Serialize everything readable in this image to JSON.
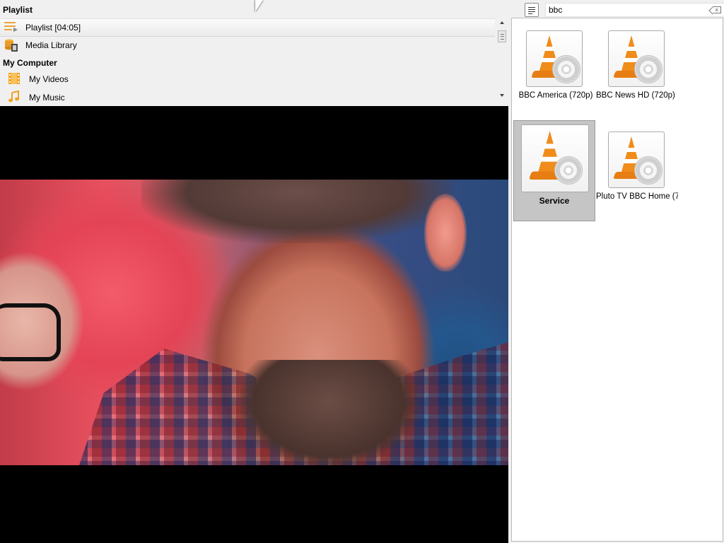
{
  "sidebar": {
    "playlist_header": "Playlist",
    "items": [
      {
        "label": "Playlist [04:05]",
        "icon": "playlist-icon",
        "selected": true
      },
      {
        "label": "Media Library",
        "icon": "media-library-icon"
      }
    ],
    "computer_header": "My Computer",
    "computer_items": [
      {
        "label": "My Videos",
        "icon": "film-icon"
      },
      {
        "label": "My Music",
        "icon": "music-note-icon"
      }
    ]
  },
  "search": {
    "value": "bbc"
  },
  "results": [
    {
      "label": "BBC America (720p)",
      "icon": "vlc-cone-icon"
    },
    {
      "label": "BBC News HD (720p) ...",
      "icon": "vlc-cone-icon"
    },
    {
      "label": "Service",
      "icon": "vlc-cone-icon",
      "selected": true
    },
    {
      "label": "Pluto TV BBC Home (7...",
      "icon": "vlc-cone-icon"
    }
  ],
  "colors": {
    "accent_orange": "#f08c1a",
    "selection_gray": "#c5c5c5",
    "panel_bg": "#f0f0f0"
  }
}
